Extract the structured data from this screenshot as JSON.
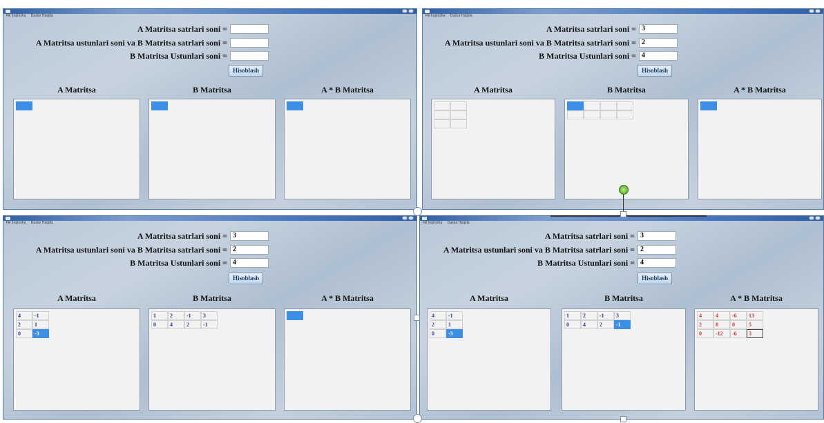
{
  "menu": [
    "Fili Inqirosha",
    "Dastur Haqida"
  ],
  "labels": {
    "a_rows": "A Matritsa satrlari soni =",
    "a_cols_b_rows": "A Matritsa ustunlari soni va B Matritsa satrlari soni =",
    "b_cols": "B Matritsa Ustunlari soni =",
    "button": "Hisoblash",
    "panel_a": "A Matritsa",
    "panel_b": "B Matritsa",
    "panel_ab": "A * B Matritsa"
  },
  "windows": [
    {
      "inputs": [
        "",
        "",
        ""
      ],
      "a": [
        [
          ""
        ]
      ],
      "a_sel": [
        0,
        0
      ],
      "b": [
        [
          ""
        ]
      ],
      "b_sel": [
        0,
        0
      ],
      "ab": [
        [
          ""
        ]
      ],
      "ab_sel": [
        0,
        0
      ],
      "ab_red": false
    },
    {
      "inputs": [
        "3",
        "2",
        "4"
      ],
      "a": [
        [
          "",
          ""
        ],
        [
          "",
          ""
        ],
        [
          "",
          ""
        ]
      ],
      "a_sel": null,
      "b": [
        [
          "",
          "",
          "",
          ""
        ],
        [
          "",
          "",
          "",
          ""
        ]
      ],
      "b_sel": [
        0,
        0
      ],
      "ab": [
        [
          ""
        ]
      ],
      "ab_sel": [
        0,
        0
      ],
      "ab_red": false
    },
    {
      "inputs": [
        "3",
        "2",
        "4"
      ],
      "a": [
        [
          "4",
          "-1"
        ],
        [
          "2",
          "1"
        ],
        [
          "0",
          "-3"
        ]
      ],
      "a_sel": [
        2,
        1
      ],
      "b": [
        [
          "1",
          "2",
          "-1",
          "3"
        ],
        [
          "0",
          "4",
          "2",
          "-1"
        ]
      ],
      "b_sel": null,
      "ab": [
        [
          ""
        ]
      ],
      "ab_sel": [
        0,
        0
      ],
      "ab_red": false
    },
    {
      "inputs": [
        "3",
        "2",
        "4"
      ],
      "a": [
        [
          "4",
          "-1"
        ],
        [
          "2",
          "1"
        ],
        [
          "0",
          "-3"
        ]
      ],
      "a_sel": [
        2,
        1
      ],
      "b": [
        [
          "1",
          "2",
          "-1",
          "3"
        ],
        [
          "0",
          "4",
          "2",
          "-1"
        ]
      ],
      "b_sel": [
        1,
        3
      ],
      "ab": [
        [
          "4",
          "4",
          "-6",
          "13"
        ],
        [
          "2",
          "8",
          "0",
          "5"
        ],
        [
          "0",
          "-12",
          "-6",
          "3"
        ]
      ],
      "ab_sel": null,
      "ab_red": true
    }
  ],
  "accent_color": "#3b8fe6",
  "result_color": "#e03030"
}
